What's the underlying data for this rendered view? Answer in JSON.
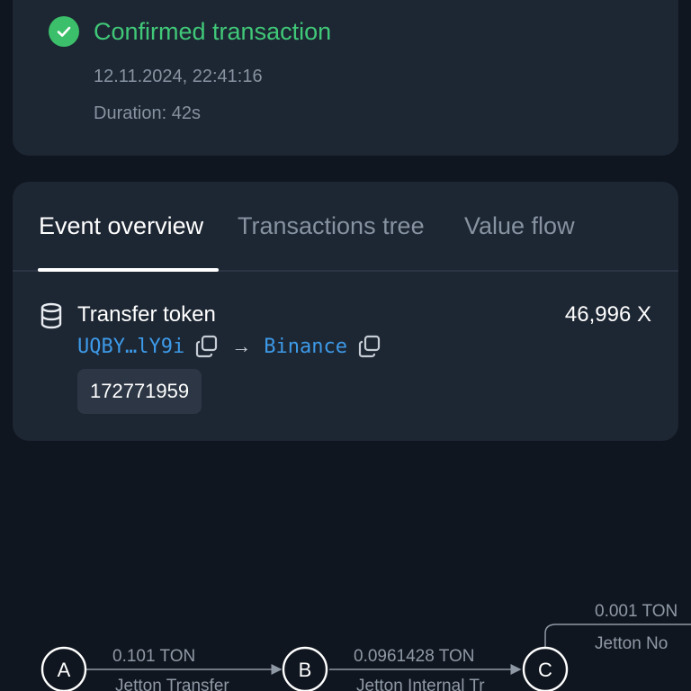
{
  "status": {
    "title": "Confirmed transaction",
    "datetime": "12.11.2024, 22:41:16",
    "duration": "Duration: 42s",
    "color": "#40c878"
  },
  "tabs": [
    {
      "label": "Event overview",
      "active": true
    },
    {
      "label": "Transactions tree",
      "active": false
    },
    {
      "label": "Value flow",
      "active": false
    }
  ],
  "event": {
    "icon": "database-icon",
    "title": "Transfer token",
    "amount": "46,996 X",
    "from": "UQBY…lY9i",
    "to": "Binance",
    "arrow": "→",
    "id": "172771959",
    "link_color": "#3d9ae8"
  },
  "flow": {
    "nodes": [
      "A",
      "B",
      "C"
    ],
    "edges": [
      {
        "value": "0.101 TON",
        "label": "Jetton Transfer"
      },
      {
        "value": "0.0961428 TON",
        "label": "Jetton Internal Tr"
      },
      {
        "value": "0.001 TON",
        "label": "Jetton No"
      }
    ]
  }
}
